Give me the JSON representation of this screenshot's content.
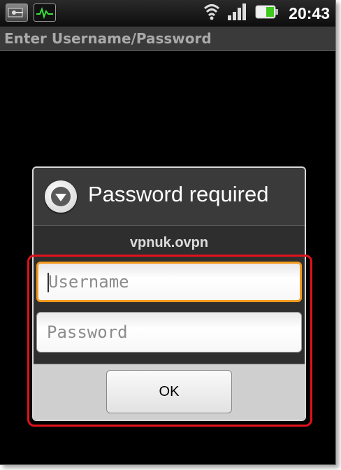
{
  "status_bar": {
    "clock": "20:43",
    "icons": [
      "vpn-key-icon",
      "activity-monitor-icon",
      "wifi-icon",
      "signal-icon",
      "battery-icon"
    ],
    "battery_color": "#3ec81e"
  },
  "app": {
    "title": "Enter Username/Password"
  },
  "dialog": {
    "title": "Password required",
    "message": "vpnuk.ovpn",
    "icon": "chevron-down-circle-icon",
    "username_placeholder": "Username",
    "password_placeholder": "Password",
    "ok_label": "OK"
  },
  "colors": {
    "focus_border": "#f39a1e",
    "highlight": "#e0121b"
  }
}
